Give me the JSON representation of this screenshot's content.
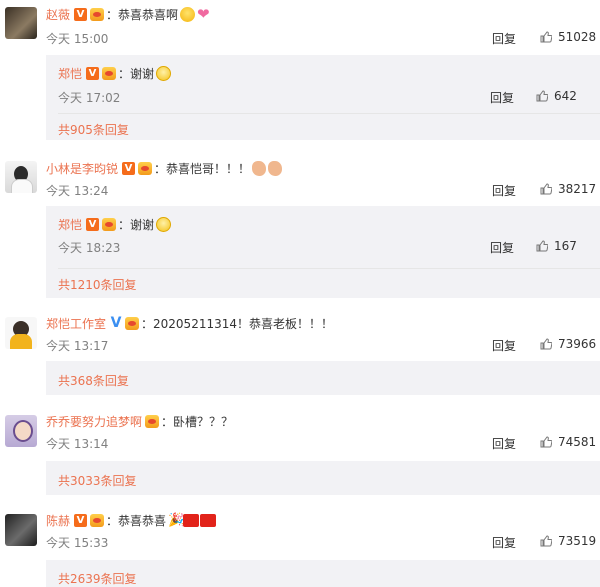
{
  "comments": [
    {
      "user": "赵薇",
      "text": "：恭喜恭喜啊",
      "time": "今天 15:00",
      "reply_label": "回复",
      "likes": "51028",
      "reply": {
        "user": "郑恺",
        "text": "：谢谢",
        "time": "今天 17:02",
        "reply_label": "回复",
        "likes": "642"
      },
      "more": "共905条回复"
    },
    {
      "user": "小林是李昀锐",
      "text": "：恭喜恺哥！！！",
      "time": "今天 13:24",
      "reply_label": "回复",
      "likes": "38217",
      "reply": {
        "user": "郑恺",
        "text": "：谢谢",
        "time": "今天 18:23",
        "reply_label": "回复",
        "likes": "167"
      },
      "more": "共1210条回复"
    },
    {
      "user": "郑恺工作室",
      "text": "：20205211314！恭喜老板！！！",
      "time": "今天 13:17",
      "reply_label": "回复",
      "likes": "73966",
      "more": "共368条回复"
    },
    {
      "user": "乔乔要努力追梦啊",
      "text": "：卧槽？？？",
      "time": "今天 13:14",
      "reply_label": "回复",
      "likes": "74581",
      "more": "共3033条回复"
    },
    {
      "user": "陈赫",
      "text": "：恭喜恭喜",
      "time": "今天 15:33",
      "reply_label": "回复",
      "likes": "73519",
      "more": "共2639条回复"
    }
  ],
  "icons": {
    "verified_badge": "V",
    "like": "thumbs-up-icon",
    "vip": "crown-icon"
  },
  "colors": {
    "username": "#eb7350",
    "verified": "#f56c1b",
    "verified_blue": "#3b8ff1",
    "reply_box_bg": "#f2f2f5",
    "time": "#808080"
  }
}
